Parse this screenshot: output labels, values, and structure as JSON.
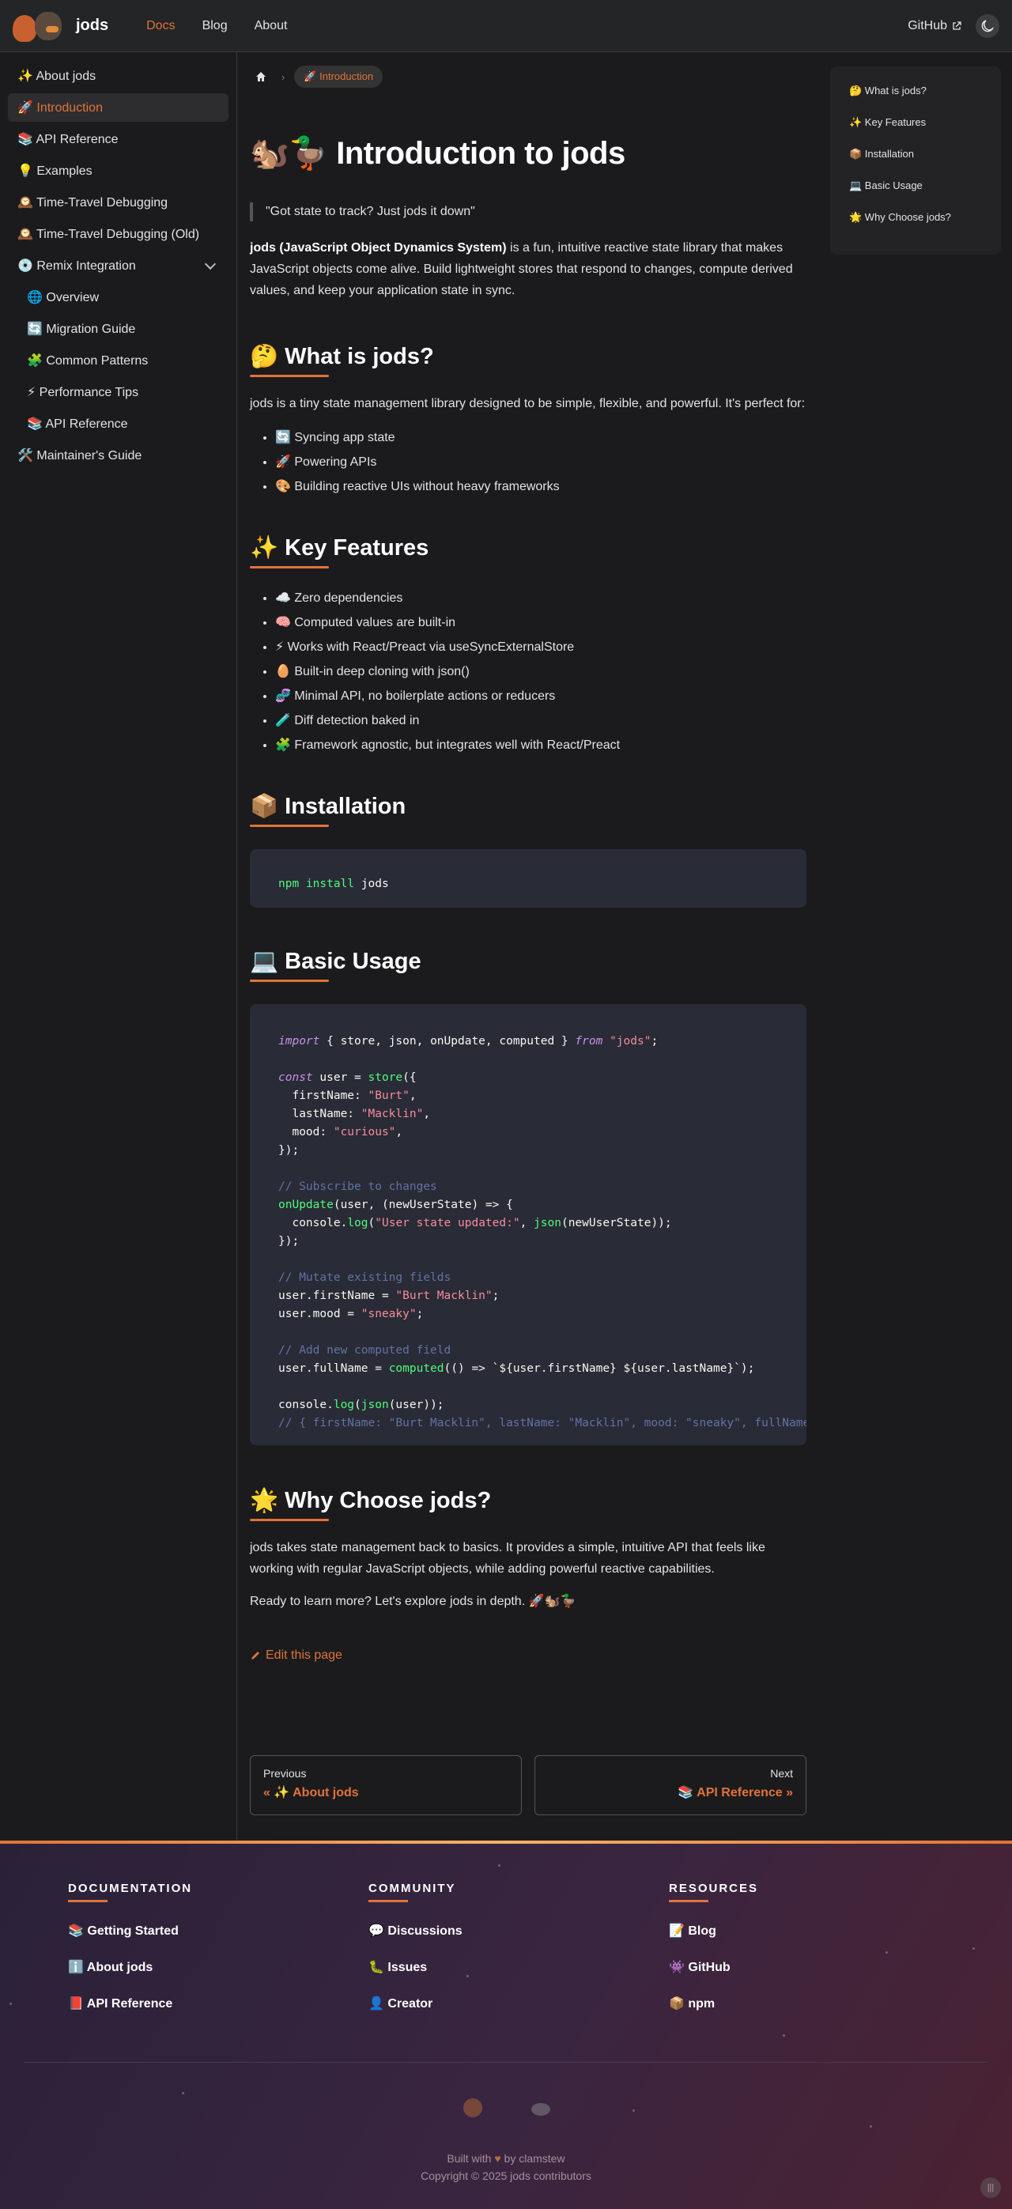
{
  "navbar": {
    "brand": "jods",
    "links": [
      "Docs",
      "Blog",
      "About"
    ],
    "github": "GitHub"
  },
  "sidebar": {
    "items": [
      {
        "label": "✨ About jods"
      },
      {
        "label": "🚀 Introduction"
      },
      {
        "label": "📚 API Reference"
      },
      {
        "label": "💡 Examples"
      },
      {
        "label": "🕰️ Time-Travel Debugging"
      },
      {
        "label": "🕰️ Time-Travel Debugging (Old)"
      },
      {
        "label": "💿 Remix Integration"
      },
      {
        "label": "🌐 Overview"
      },
      {
        "label": "🔄 Migration Guide"
      },
      {
        "label": "🧩 Common Patterns"
      },
      {
        "label": "⚡ Performance Tips"
      },
      {
        "label": "📚 API Reference"
      },
      {
        "label": "🛠️ Maintainer's Guide"
      }
    ]
  },
  "breadcrumb": {
    "current": "🚀 Introduction"
  },
  "content": {
    "title": "🐿️🦆 Introduction to jods",
    "quote": "\"Got state to track? Just jods it down\"",
    "intro_strong": "jods (JavaScript Object Dynamics System)",
    "intro_rest": " is a fun, intuitive reactive state library that makes JavaScript objects come alive. Build lightweight stores that respond to changes, compute derived values, and keep your application state in sync.",
    "what_title": "🤔 What is jods?",
    "what_text": "jods is a tiny state management library designed to be simple, flexible, and powerful. It's perfect for:",
    "what_list": [
      "🔄 Syncing app state",
      "🚀 Powering APIs",
      "🎨 Building reactive UIs without heavy frameworks"
    ],
    "features_title": "✨ Key Features",
    "features_list": [
      "☁️ Zero dependencies",
      "🧠 Computed values are built-in",
      "⚡ Works with React/Preact via useSyncExternalStore",
      "🥚 Built-in deep cloning with json()",
      "🧬 Minimal API, no boilerplate actions or reducers",
      "🧪 Diff detection baked in",
      "🧩 Framework agnostic, but integrates well with React/Preact"
    ],
    "install_title": "📦 Installation",
    "install_cmd": [
      "npm",
      "install",
      "jods"
    ],
    "usage_title": "💻 Basic Usage",
    "why_title": "🌟 Why Choose jods?",
    "why_text": "jods takes state management back to basics. It provides a simple, intuitive API that feels like working with regular JavaScript objects, while adding powerful reactive capabilities.",
    "why_text2": "Ready to learn more? Let's explore jods in depth. 🚀🐿️🦆",
    "edit": "Edit this page"
  },
  "pager": {
    "prev_label": "Previous",
    "prev_title": "« ✨ About jods",
    "next_label": "Next",
    "next_title": "📚 API Reference »"
  },
  "toc": [
    "🤔 What is jods?",
    "✨ Key Features",
    "📦 Installation",
    "💻 Basic Usage",
    "🌟 Why Choose jods?"
  ],
  "footer": {
    "docs_head": "DOCUMENTATION",
    "docs": [
      "📚 Getting Started",
      "ℹ️ About jods",
      "📕 API Reference"
    ],
    "community_head": "COMMUNITY",
    "community": [
      "💬 Discussions",
      "🐛 Issues",
      "👤 Creator"
    ],
    "resources_head": "RESOURCES",
    "resources": [
      "📝 Blog",
      "👾 GitHub",
      "📦 npm"
    ],
    "built_pre": "Built with",
    "built_post": "by clamstew",
    "copyright": "Copyright © 2025 jods contributors"
  },
  "colors": {
    "accent": "#e0733a",
    "background": "#1b1b1d",
    "code_bg": "#292b36"
  }
}
